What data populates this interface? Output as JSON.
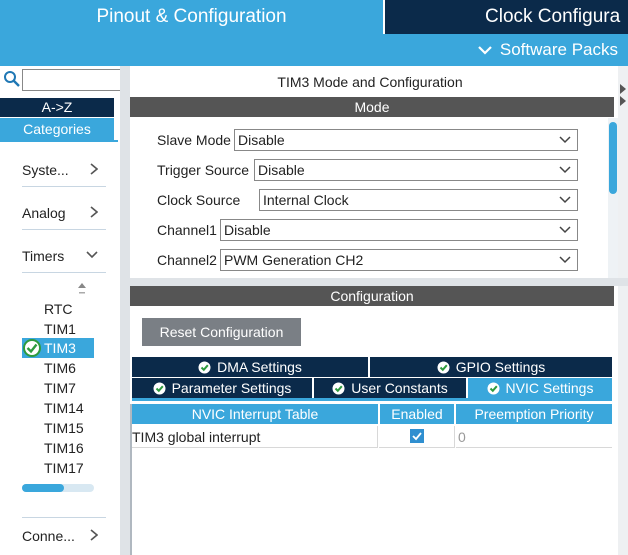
{
  "tabs": {
    "pinout": "Pinout & Configuration",
    "clock": "Clock Configura"
  },
  "software_packs": "Software Packs",
  "sidebar": {
    "search_placeholder": "",
    "az_label": "A->Z",
    "categories_label": "Categories",
    "categories": [
      {
        "label": "Syste...",
        "expanded": false
      },
      {
        "label": "Analog",
        "expanded": false
      },
      {
        "label": "Timers",
        "expanded": true
      },
      {
        "label": "Conne...",
        "expanded": false
      }
    ],
    "timers": [
      "RTC",
      "TIM1",
      "TIM3",
      "TIM6",
      "TIM7",
      "TIM14",
      "TIM15",
      "TIM16",
      "TIM17"
    ],
    "selected_timer": "TIM3",
    "scroll_fraction": 0.58
  },
  "mode_panel": {
    "title": "TIM3 Mode and Configuration",
    "header": "Mode",
    "fields": [
      {
        "label": "Slave Mode",
        "value": "Disable"
      },
      {
        "label": "Trigger Source",
        "value": "Disable"
      },
      {
        "label": "Clock Source",
        "value": "Internal Clock"
      },
      {
        "label": "Channel1",
        "value": "Disable"
      },
      {
        "label": "Channel2",
        "value": "PWM Generation CH2"
      }
    ]
  },
  "config_panel": {
    "header": "Configuration",
    "reset_label": "Reset Configuration",
    "tabs_row1": [
      "DMA Settings",
      "GPIO Settings"
    ],
    "tabs_row2": [
      "Parameter Settings",
      "User Constants",
      "NVIC Settings"
    ],
    "active_tab": "NVIC Settings",
    "table": {
      "columns": [
        "NVIC Interrupt Table",
        "Enabled",
        "Preemption Priority"
      ],
      "rows": [
        {
          "name": "TIM3 global interrupt",
          "enabled": true,
          "priority": "0"
        }
      ]
    }
  },
  "colors": {
    "accent": "#3aa7dc",
    "dark": "#0b2a4a",
    "header_gray": "#555555"
  }
}
